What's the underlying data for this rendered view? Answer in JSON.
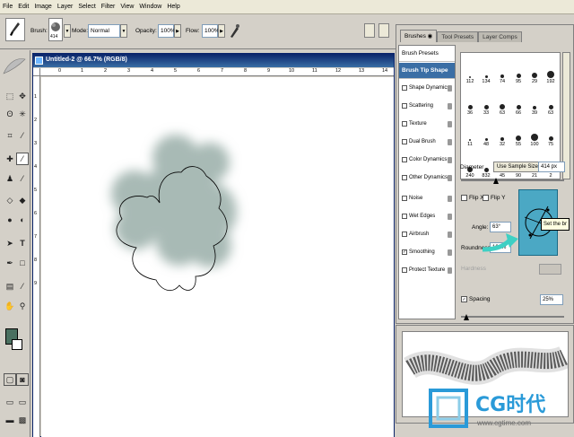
{
  "menu": [
    "File",
    "Edit",
    "Image",
    "Layer",
    "Select",
    "Filter",
    "View",
    "Window",
    "Help"
  ],
  "options_bar": {
    "brush_label": "Brush:",
    "brush_size": "414",
    "mode_label": "Mode:",
    "mode_value": "Normal",
    "opacity_label": "Opacity:",
    "opacity_value": "100%",
    "flow_label": "Flow:",
    "flow_value": "100%"
  },
  "document": {
    "title": "Untitled-2 @ 66.7% (RGB/8)",
    "ruler_h": [
      "0",
      "1",
      "2",
      "3",
      "4",
      "5",
      "6",
      "7",
      "8",
      "9",
      "10",
      "11",
      "12",
      "13",
      "14"
    ],
    "ruler_v": [
      "1",
      "2",
      "3",
      "4",
      "5",
      "6",
      "7",
      "8",
      "9"
    ]
  },
  "palette": {
    "tabs": [
      "Brushes",
      "Tool Presets",
      "Layer Comps"
    ],
    "brush_presets": "Brush Presets",
    "brush_tip_shape": "Brush Tip Shape",
    "options": [
      {
        "label": "Shape Dynamics",
        "checked": false
      },
      {
        "label": "Scattering",
        "checked": false
      },
      {
        "label": "Texture",
        "checked": false
      },
      {
        "label": "Dual Brush",
        "checked": false
      },
      {
        "label": "Color Dynamics",
        "checked": false
      },
      {
        "label": "Other Dynamics",
        "checked": false
      },
      {
        "label": "Noise",
        "checked": false
      },
      {
        "label": "Wet Edges",
        "checked": false
      },
      {
        "label": "Airbrush",
        "checked": false
      },
      {
        "label": "Smoothing",
        "checked": true
      },
      {
        "label": "Protect Texture",
        "checked": false
      }
    ],
    "brush_grid_rows": [
      [
        "112",
        "134",
        "74",
        "95",
        "29",
        "192"
      ],
      [
        "36",
        "33",
        "63",
        "66",
        "39",
        "63"
      ],
      [
        "11",
        "48",
        "32",
        "55",
        "100",
        "75"
      ],
      [
        "240",
        "832",
        "45",
        "90",
        "21",
        "2"
      ]
    ],
    "diameter_label": "Diameter",
    "use_sample_size": "Use Sample Size",
    "diameter_value": "414 px",
    "flip_x": "Flip X",
    "flip_y": "Flip Y",
    "angle_label": "Angle:",
    "angle_value": "63°",
    "roundness_label": "Roundness:",
    "roundness_value": "100%",
    "hardness_label": "Hardness",
    "spacing_label": "Spacing",
    "spacing_value": "25%",
    "tooltip": "Set the br"
  },
  "watermark": {
    "brand": "CG时代",
    "url": "www.cgtime.com"
  },
  "colors": {
    "foreground": "#4a7060",
    "cloud": "#a8bab5",
    "title_bar": "#0a246a",
    "accent": "#3a6ea5"
  }
}
